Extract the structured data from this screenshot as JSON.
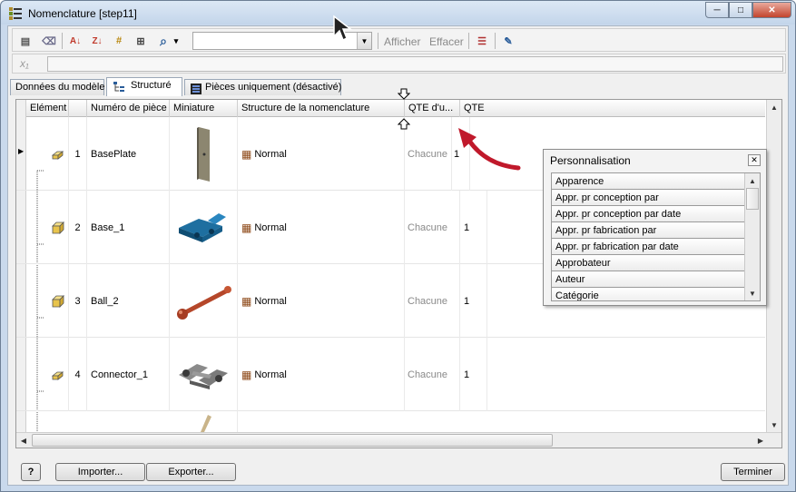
{
  "window": {
    "title": "Nomenclature [step11]",
    "controls": {
      "minimize": "─",
      "maximize": "□",
      "close": "✕"
    }
  },
  "toolbar": {
    "buttons": [
      {
        "name": "bom-properties-icon",
        "glyph": "▤"
      },
      {
        "name": "eraser-icon",
        "glyph": "⌫"
      },
      {
        "name": "sort-az-icon",
        "glyph": "A↓"
      },
      {
        "name": "sort-za-icon",
        "glyph": "Z↓"
      },
      {
        "name": "renumber-icon",
        "glyph": "#"
      },
      {
        "name": "export-table-icon",
        "glyph": "⊞"
      },
      {
        "name": "find-icon",
        "glyph": "⌕"
      }
    ],
    "find_dropdown": "▾",
    "combo_value": "",
    "combo_arrow": "▼",
    "show_label": "Afficher",
    "clear_label": "Effacer",
    "right_buttons": [
      {
        "name": "column-chooser-icon",
        "glyph": "☰"
      },
      {
        "name": "edit-settings-icon",
        "glyph": "✎"
      }
    ]
  },
  "formula_bar": {
    "fx": "x₁",
    "value": ""
  },
  "tabs": [
    {
      "label": "Données du modèle",
      "active": false
    },
    {
      "label": "Structuré",
      "active": true
    },
    {
      "label": "Pièces uniquement (désactivé)",
      "active": false
    }
  ],
  "grid": {
    "columns": [
      "Elément",
      "Numéro de pièce",
      "Miniature",
      "Structure de la nomenclature",
      "QTE d'u...",
      "QTE"
    ],
    "rows": [
      {
        "item": "1",
        "part": "BasePlate",
        "structure": "Normal",
        "unit_qty": "Chacune",
        "qty": "1"
      },
      {
        "item": "2",
        "part": "Base_1",
        "structure": "Normal",
        "unit_qty": "Chacune",
        "qty": "1"
      },
      {
        "item": "3",
        "part": "Ball_2",
        "structure": "Normal",
        "unit_qty": "Chacune",
        "qty": "1"
      },
      {
        "item": "4",
        "part": "Connector_1",
        "structure": "Normal",
        "unit_qty": "Chacune",
        "qty": "1"
      }
    ],
    "current_row_marker": "▶"
  },
  "customize_popup": {
    "title": "Personnalisation",
    "close": "✕",
    "items": [
      "Apparence",
      "Appr. pr conception par",
      "Appr. pr conception par date",
      "Appr. pr fabrication par",
      "Appr. pr fabrication par date",
      "Approbateur",
      "Auteur",
      "Catégorie"
    ]
  },
  "bottom": {
    "help": "?",
    "import_label": "Importer...",
    "export_label": "Exporter...",
    "done_label": "Terminer"
  },
  "colors": {
    "title_bar": "#c3d5ea",
    "close_button": "#c2442c",
    "annotation_arrow": "#c0192b"
  }
}
